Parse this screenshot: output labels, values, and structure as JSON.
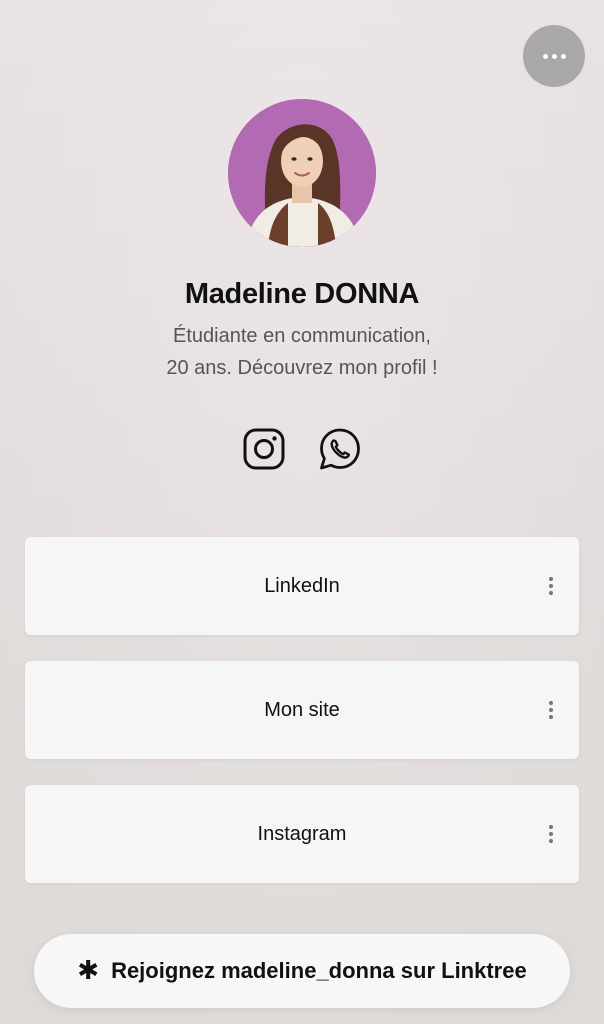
{
  "header": {
    "more_icon": "more-horizontal-icon"
  },
  "profile": {
    "name": "Madeline DONNA",
    "bio_line_1": "Étudiante en communication,",
    "bio_line_2": "20 ans. Découvrez mon profil !",
    "avatar_bg": "#b26bb3"
  },
  "social": [
    {
      "name": "instagram",
      "icon": "instagram-icon"
    },
    {
      "name": "whatsapp",
      "icon": "whatsapp-icon"
    }
  ],
  "links": [
    {
      "label": "LinkedIn"
    },
    {
      "label": "Mon site"
    },
    {
      "label": "Instagram"
    }
  ],
  "footer": {
    "icon": "linktree-asterisk-icon",
    "join_label": "Rejoignez madeline_donna sur Linktree"
  },
  "colors": {
    "card_bg": "#f7f6f6",
    "text": "#111111",
    "bio_text": "#555555",
    "more_button_bg": "#a9a7a7"
  }
}
